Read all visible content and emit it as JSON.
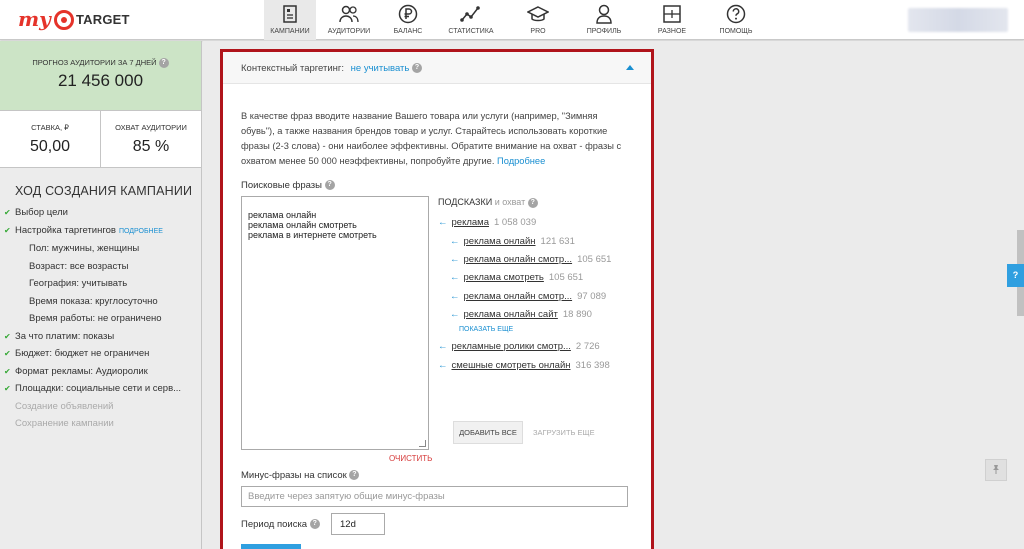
{
  "header": {
    "logo": {
      "prefix": "my",
      "suffix": "TARGET",
      "brand_color": "#e5332a"
    },
    "nav": [
      {
        "label": "КАМПАНИИ",
        "icon": "campaigns-icon",
        "active": true
      },
      {
        "label": "АУДИТОРИИ",
        "icon": "audiences-icon",
        "active": false
      },
      {
        "label": "БАЛАНС",
        "icon": "ruble-icon",
        "active": false
      },
      {
        "label": "СТАТИСТИКА",
        "icon": "statistics-icon",
        "active": false
      },
      {
        "label": "PRO",
        "icon": "graduation-cap-icon",
        "active": false
      },
      {
        "label": "ПРОФИЛЬ",
        "icon": "profile-icon",
        "active": false
      },
      {
        "label": "РАЗНОЕ",
        "icon": "misc-icon",
        "active": false
      },
      {
        "label": "ПОМОЩЬ",
        "icon": "help-icon",
        "active": false
      }
    ]
  },
  "sidebar": {
    "forecast": {
      "title": "ПРОГНОЗ АУДИТОРИИ ЗА 7 ДНЕЙ",
      "value": "21 456 000"
    },
    "rate": {
      "title": "СТАВКА, ₽",
      "value": "50,00"
    },
    "reach": {
      "title": "ОХВАТ АУДИТОРИИ",
      "value": "85 %"
    },
    "steps_title": "ХОД СОЗДАНИЯ КАМПАНИИ",
    "steps": [
      {
        "label": "Выбор цели",
        "done": true
      },
      {
        "label": "Настройка таргетингов",
        "done": true,
        "link": "ПОДРОБНЕЕ"
      },
      {
        "label": "Пол: мужчины, женщины",
        "sub": true
      },
      {
        "label": "Возраст: все возрасты",
        "sub": true
      },
      {
        "label": "География: учитывать",
        "sub": true
      },
      {
        "label": "Время показа: круглосуточно",
        "sub": true
      },
      {
        "label": "Время работы: не ограничено",
        "sub": true
      },
      {
        "label": "За что платим: показы",
        "done": true
      },
      {
        "label": "Бюджет: бюджет не ограничен",
        "done": true
      },
      {
        "label": "Формат рекламы: Аудиоролик",
        "done": true
      },
      {
        "label": "Площадки: социальные сети и серв...",
        "done": true
      },
      {
        "label": "Создание объявлений",
        "disabled": true
      },
      {
        "label": "Сохранение кампании",
        "disabled": true
      }
    ]
  },
  "panel": {
    "header_label": "Контекстный таргетинг:",
    "header_value": "не учитывать",
    "description": "В качестве фраз вводите название Вашего товара или услуги (например, \"Зимняя обувь\"), а также названия брендов товар и услуг. Старайтесь использовать короткие фразы (2-3 слова) - они наиболее эффективны. Обратите внимание на охват - фразы с охватом менее 50 000 неэффективны, попробуйте другие.",
    "description_link": "Подробнее",
    "search_label": "Поисковые фразы",
    "phrases": "реклама онлайн\nреклама онлайн смотреть\nреклама в интернете смотреть",
    "clear": "ОЧИСТИТЬ",
    "suggestions_title": "ПОДСКАЗКИ",
    "suggestions_subtitle": "и охват",
    "suggestions": [
      {
        "text": "реклама",
        "count": "1 058 039",
        "level": 0
      },
      {
        "text": "реклама онлайн",
        "count": "121 631",
        "level": 1
      },
      {
        "text": "реклама онлайн смотр...",
        "count": "105 651",
        "level": 1
      },
      {
        "text": "реклама смотреть",
        "count": "105 651",
        "level": 1
      },
      {
        "text": "реклама онлайн смотр...",
        "count": "97 089",
        "level": 1
      },
      {
        "text": "реклама онлайн сайт",
        "count": "18 890",
        "level": 1
      },
      {
        "text": "рекламные ролики смотр...",
        "count": "2 726",
        "level": 0
      },
      {
        "text": "смешные смотреть онлайн",
        "count": "316 398",
        "level": 0
      }
    ],
    "show_more": "ПОКАЗАТЬ ЕЩЕ",
    "add_all": "ДОБАВИТЬ ВСЕ",
    "load_more": "ЗАГРУЗИТЬ ЕЩЕ",
    "minus_label": "Минус-фразы на список",
    "minus_placeholder": "Введите через запятую общие минус-фразы",
    "period_label": "Период поиска",
    "period_value": "12d"
  },
  "floating": {
    "help": "?"
  }
}
